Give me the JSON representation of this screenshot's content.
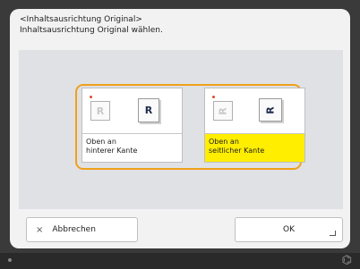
{
  "dialog": {
    "title": "<Inhaltsausrichtung Original>",
    "instruction": "Inhaltsausrichtung Original wählen."
  },
  "options": [
    {
      "line1": "Oben an",
      "line2": "hinterer Kante",
      "icon_back": "R",
      "icon_front": "R",
      "selected": false
    },
    {
      "line1": "Oben an",
      "line2": "seitlicher Kante",
      "icon_back": "𝗥",
      "icon_front": "𝗥",
      "selected": true
    }
  ],
  "buttons": {
    "cancel_label": "Abbrechen",
    "cancel_icon": "×",
    "ok_label": "OK"
  },
  "colors": {
    "selected_highlight": "#ffee00",
    "frame_accent": "#f0a11a"
  }
}
